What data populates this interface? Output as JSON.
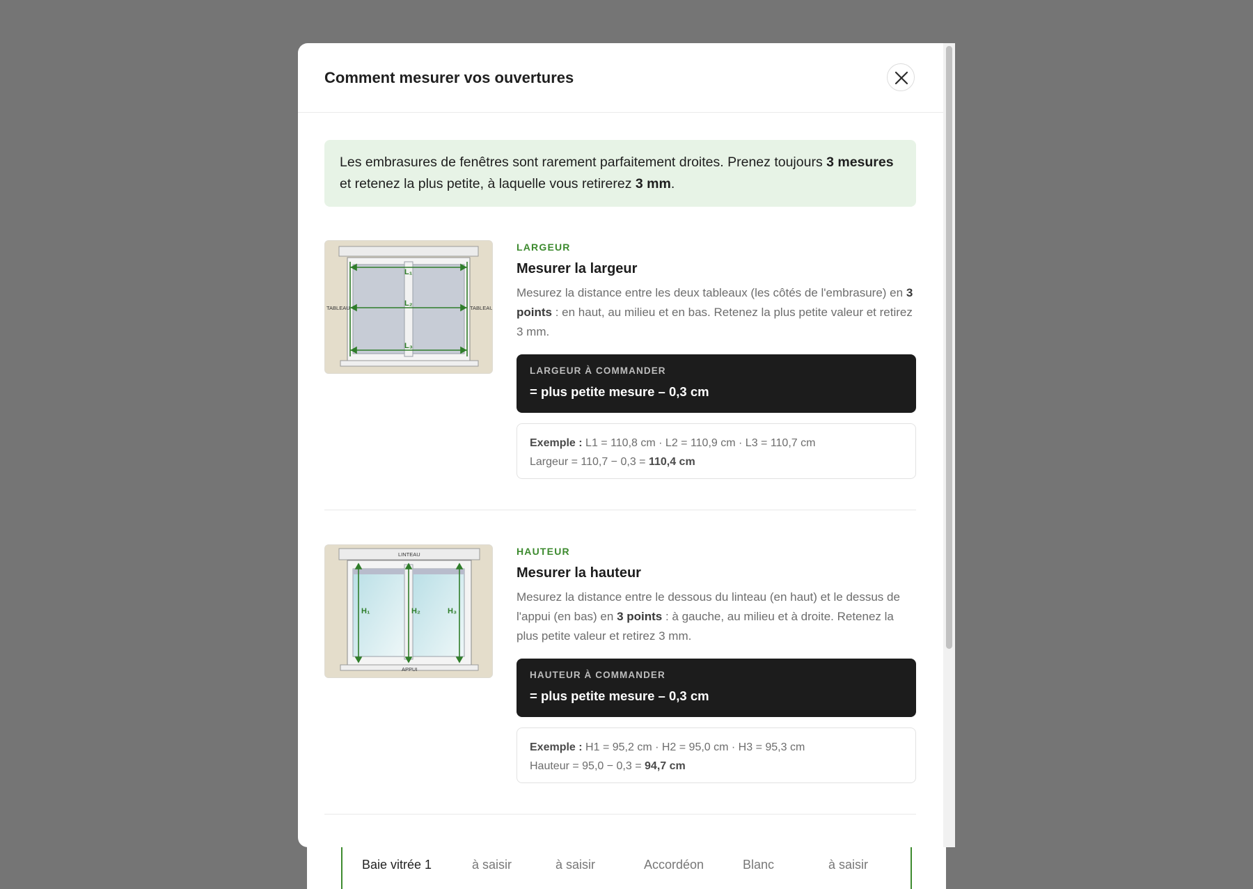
{
  "modal": {
    "title": "Comment mesurer vos ouvertures",
    "close_label": "Fermer"
  },
  "info": {
    "text_1": "Les embrasures de fenêtres sont rarement parfaitement droites. Prenez toujours ",
    "bold_1": "3 mesures",
    "text_2": " et retenez la plus petite, à laquelle vous retirerez ",
    "bold_2": "3 mm",
    "text_3": "."
  },
  "width_section": {
    "eyebrow": "LARGEUR",
    "title": "Mesurer la largeur",
    "desc_1": "Mesurez la distance entre les deux tableaux (les côtés de l'embrasure) en ",
    "desc_bold": "3 points",
    "desc_2": " : en haut, au milieu et en bas. Retenez la plus petite valeur et retirez 3 mm.",
    "formula_label": "LARGEUR À COMMANDER",
    "formula_value": "= plus petite mesure – 0,3 cm",
    "example_bold": "Exemple :",
    "example_line1": " L1 = 110,8 cm · L2 = 110,9 cm · L3 = 110,7 cm",
    "example_line2": "Largeur = 110,7 − 0,3 = ",
    "example_result": "110,4 cm",
    "diagram": {
      "left_label": "TABLEAU",
      "right_label": "TABLEAU",
      "l1": "L₁",
      "l2": "L₂",
      "l3": "L₃"
    }
  },
  "height_section": {
    "eyebrow": "HAUTEUR",
    "title": "Mesurer la hauteur",
    "desc_1": "Mesurez la distance entre le dessous du linteau (en haut) et le dessus de l'appui (en bas) en ",
    "desc_bold": "3 points",
    "desc_2": " : à gauche, au milieu et à droite. Retenez la plus petite valeur et retirez 3 mm.",
    "formula_label": "HAUTEUR À COMMANDER",
    "formula_value": "= plus petite mesure – 0,3 cm",
    "example_bold": "Exemple :",
    "example_line1": " H1 = 95,2 cm · H2 = 95,0 cm · H3 = 95,3 cm",
    "example_line2": "Hauteur = 95,0 − 0,3 = ",
    "example_result": "94,7 cm",
    "diagram": {
      "top_label": "LINTEAU",
      "bottom_label": "APPUI",
      "h1": "H₁",
      "h2": "H₂",
      "h3": "H₃"
    }
  },
  "background_row": {
    "name": "Baie vitrée 1",
    "col1": "à saisir",
    "col2": "à saisir",
    "col3": "Accordéon",
    "col4": "Blanc",
    "col5": "à saisir"
  },
  "colors": {
    "accent_green": "#3c8a2e",
    "info_bg": "#e7f3e6",
    "formula_bg": "#1c1c1c",
    "overlay": "#757575"
  }
}
